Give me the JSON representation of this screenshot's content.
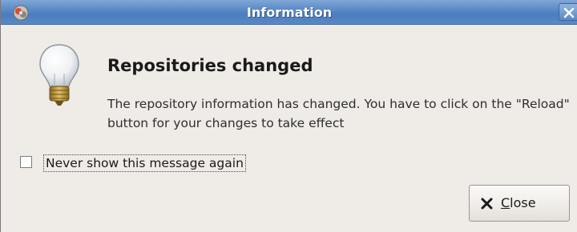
{
  "window": {
    "title": "Information"
  },
  "dialog": {
    "heading": "Repositories changed",
    "message": "The repository information has changed. You have to click on the \"Reload\" button for your changes to take effect",
    "icon": "light-bulb-icon"
  },
  "checkbox": {
    "label": "Never show this message again",
    "checked": false
  },
  "buttons": {
    "close": {
      "mnemonic": "C",
      "rest": "lose",
      "icon": "x-icon"
    }
  },
  "colors": {
    "titlebar": "#5c8ac7",
    "window_bg": "#efebe7"
  }
}
